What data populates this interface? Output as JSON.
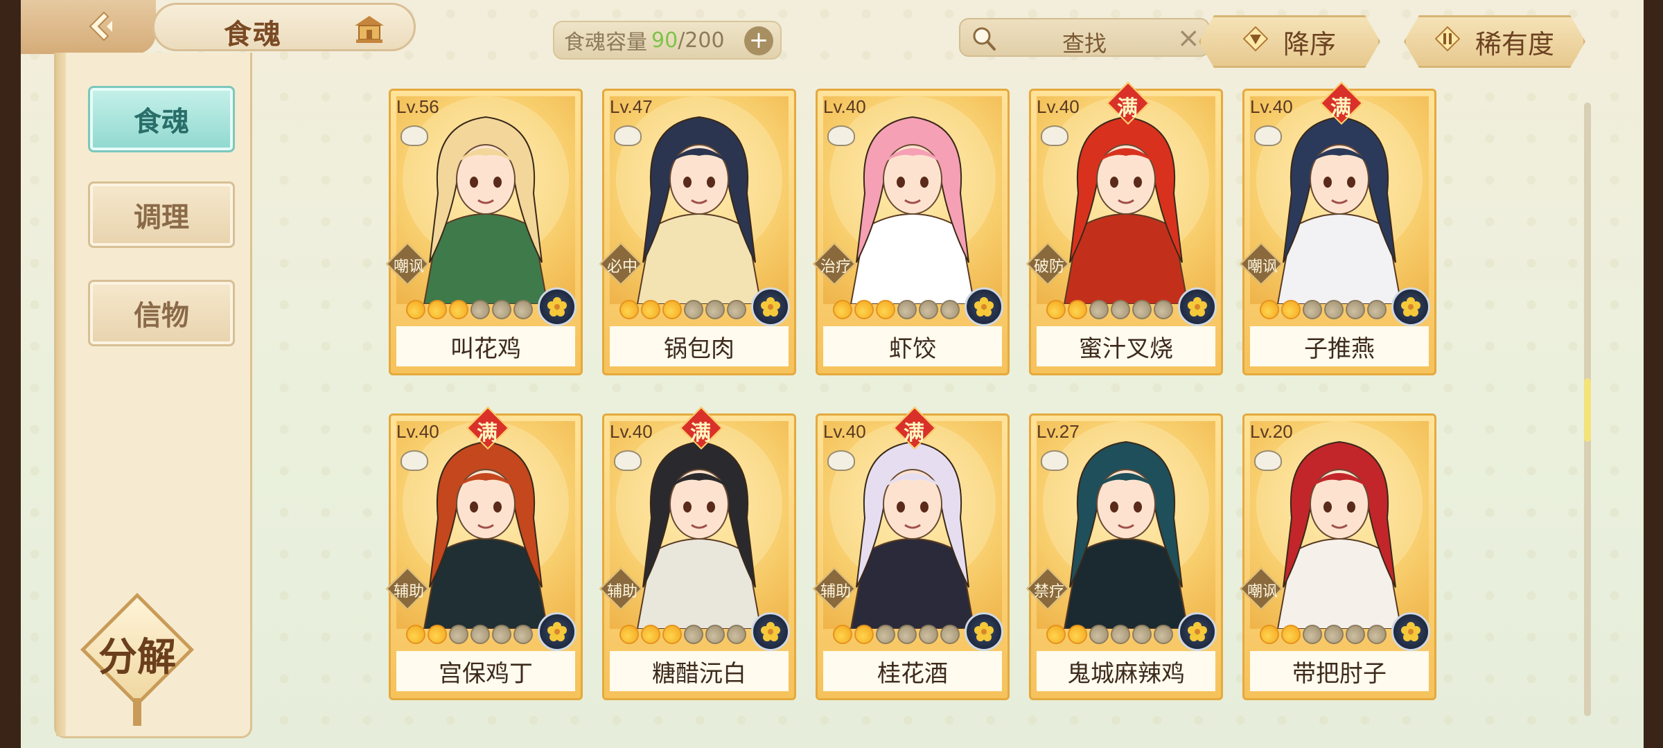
{
  "header": {
    "title": "食魂",
    "capacity_label": "食魂容量",
    "capacity_current": "90",
    "capacity_max": "/200",
    "search_label": "查找",
    "sort_order_label": "降序",
    "sort_key_label": "稀有度"
  },
  "sidebar": {
    "tabs": [
      {
        "label": "食魂",
        "active": true
      },
      {
        "label": "调理",
        "active": false
      },
      {
        "label": "信物",
        "active": false
      }
    ],
    "decompose_label": "分解"
  },
  "colors": {
    "accent_teal": "#8fd8cf",
    "gold": "#f6c25b",
    "full_badge": "#d9312a"
  },
  "cards": [
    {
      "level": "Lv.56",
      "full": false,
      "role": "嘲讽",
      "stars": 3,
      "name": "叫花鸡",
      "hair": "#f2d69a",
      "cloth": "#3f7a4a"
    },
    {
      "level": "Lv.47",
      "full": false,
      "role": "必中",
      "stars": 3,
      "name": "锅包肉",
      "hair": "#2b3550",
      "cloth": "#f3e3b3"
    },
    {
      "level": "Lv.40",
      "full": false,
      "role": "治疗",
      "stars": 3,
      "name": "虾饺",
      "hair": "#f5a0b4",
      "cloth": "#ffffff"
    },
    {
      "level": "Lv.40",
      "full": true,
      "role": "破防",
      "stars": 2,
      "name": "蜜汁叉烧",
      "hair": "#d8321f",
      "cloth": "#c2301c"
    },
    {
      "level": "Lv.40",
      "full": true,
      "role": "嘲讽",
      "stars": 2,
      "name": "子推燕",
      "hair": "#2b3a5a",
      "cloth": "#f2f2f4"
    },
    {
      "level": "Lv.40",
      "full": true,
      "role": "辅助",
      "stars": 2,
      "name": "宫保鸡丁",
      "hair": "#c4471e",
      "cloth": "#1f2f33"
    },
    {
      "level": "Lv.40",
      "full": true,
      "role": "辅助",
      "stars": 3,
      "name": "糖醋沅白",
      "hair": "#2a2a2e",
      "cloth": "#e9e6dc"
    },
    {
      "level": "Lv.40",
      "full": true,
      "role": "辅助",
      "stars": 2,
      "name": "桂花酒",
      "hair": "#e6def0",
      "cloth": "#2a2a3a"
    },
    {
      "level": "Lv.27",
      "full": false,
      "role": "禁疗",
      "stars": 2,
      "name": "鬼城麻辣鸡",
      "hair": "#1f4f5a",
      "cloth": "#1b2a30"
    },
    {
      "level": "Lv.20",
      "full": false,
      "role": "嘲讽",
      "stars": 2,
      "name": "带把肘子",
      "hair": "#c2262a",
      "cloth": "#f5f0ea"
    }
  ]
}
